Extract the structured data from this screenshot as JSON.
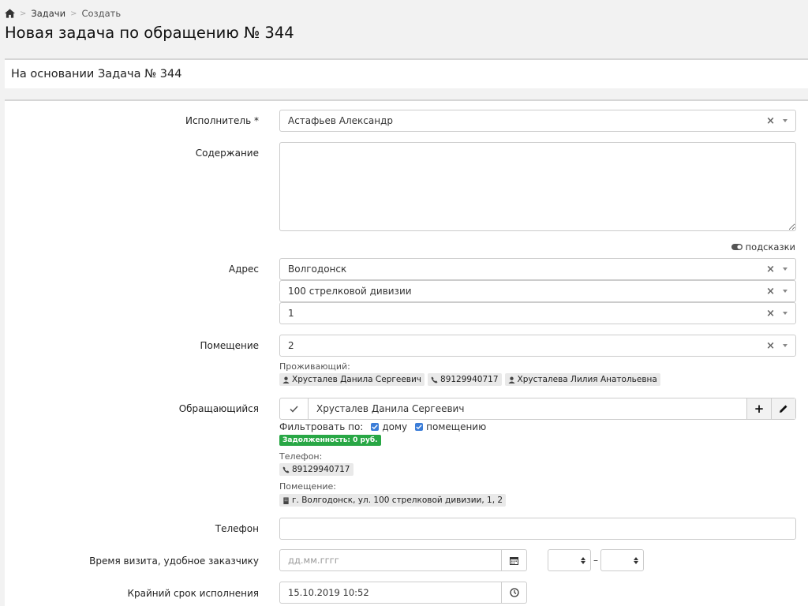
{
  "breadcrumb": {
    "items": [
      "Задачи",
      "Создать"
    ]
  },
  "page_title": "Новая задача по обращению № 344",
  "basis": {
    "title": "На основании Задача № 344"
  },
  "form": {
    "executor": {
      "label": "Исполнитель *",
      "value": "Астафьев Александр"
    },
    "content": {
      "label": "Содержание",
      "value": ""
    },
    "hints_label": "подсказки",
    "address": {
      "label": "Адрес",
      "city": "Волгодонск",
      "street": "100 стрелковой дивизии",
      "house": "1"
    },
    "premise": {
      "label": "Помещение",
      "value": "2"
    },
    "residents": {
      "label": "Проживающий:",
      "items": [
        {
          "name": "Хрусталев Данила Сергеевич",
          "phone": "89129940717"
        },
        {
          "name": "Хрусталева Лилия Анатольевна"
        }
      ]
    },
    "requester": {
      "label": "Обращающийся",
      "name": "Хрусталев Данила Сергеевич",
      "filter_label": "Фильтровать по:",
      "filter_house": "дому",
      "filter_premise": "помещению",
      "debt": "Задолженность: 0 руб.",
      "phone_label": "Телефон:",
      "phone": "89129940717",
      "premise_label": "Помещение:",
      "premise": "г. Волгодонск, ул. 100 стрелковой дивизии, 1, 2"
    },
    "phone": {
      "label": "Телефон",
      "value": ""
    },
    "visit": {
      "label": "Время визита, удобное заказчику",
      "placeholder": "дд.мм.гггг"
    },
    "deadline": {
      "label": "Крайний срок исполнения",
      "value": "15.10.2019 10:52"
    }
  }
}
